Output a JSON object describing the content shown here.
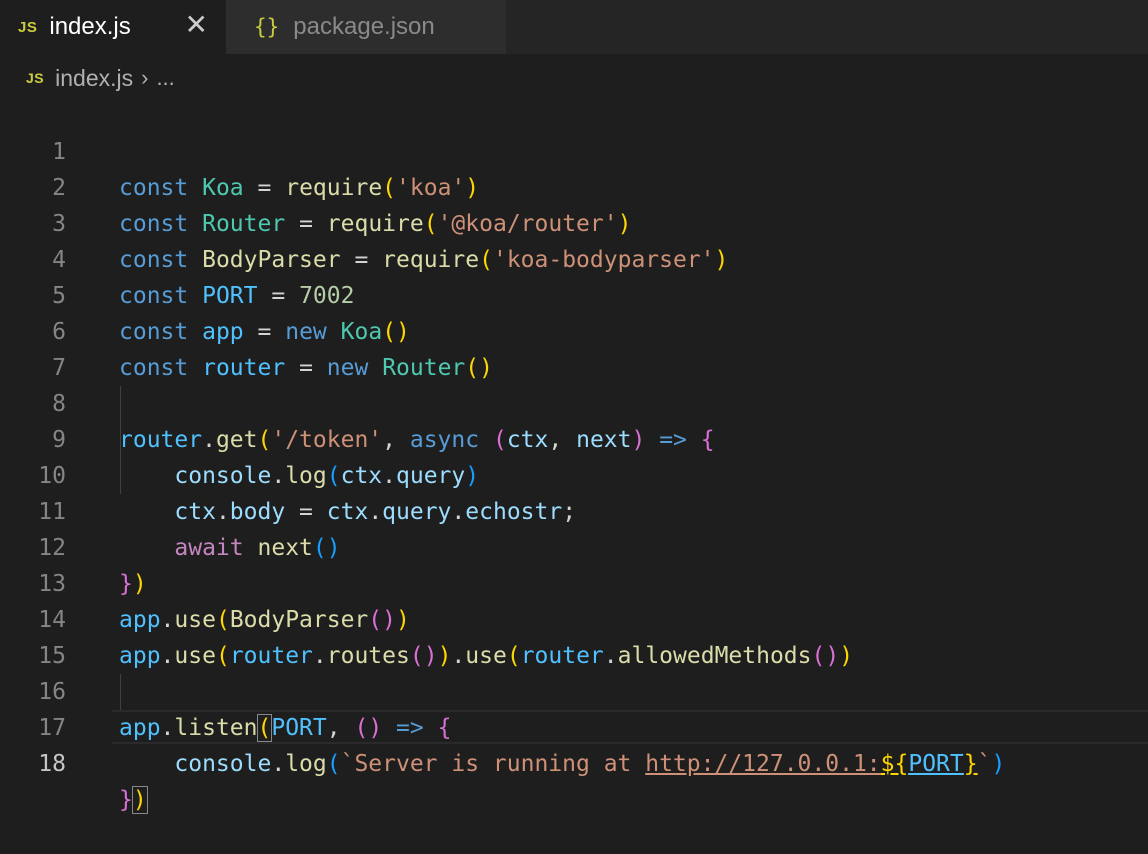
{
  "tabs": [
    {
      "icon": "JS",
      "label": "index.js",
      "active": true,
      "close": "✕"
    },
    {
      "icon": "{}",
      "label": "package.json",
      "active": false
    }
  ],
  "breadcrumb": {
    "icon": "JS",
    "file": "index.js",
    "separator": "›",
    "more": "..."
  },
  "editor": {
    "current_line": 18,
    "lines": [
      {
        "n": "1"
      },
      {
        "n": "2"
      },
      {
        "n": "3"
      },
      {
        "n": "4"
      },
      {
        "n": "5"
      },
      {
        "n": "6"
      },
      {
        "n": "7"
      },
      {
        "n": "8"
      },
      {
        "n": "9"
      },
      {
        "n": "10"
      },
      {
        "n": "11"
      },
      {
        "n": "12"
      },
      {
        "n": "13"
      },
      {
        "n": "14"
      },
      {
        "n": "15"
      },
      {
        "n": "16"
      },
      {
        "n": "17"
      },
      {
        "n": "18"
      }
    ],
    "code": {
      "l1": [
        "const",
        "Koa",
        "=",
        "require",
        "(",
        "'koa'",
        ")"
      ],
      "l2": [
        "const",
        "Router",
        "=",
        "require",
        "(",
        "'@koa/router'",
        ")"
      ],
      "l3": [
        "const",
        "BodyParser",
        "=",
        "require",
        "(",
        "'koa-bodyparser'",
        ")"
      ],
      "l4": [
        "const",
        "PORT",
        "=",
        "7002"
      ],
      "l5": [
        "const",
        "app",
        "=",
        "new",
        "Koa",
        "()"
      ],
      "l6": [
        "const",
        "router",
        "=",
        "new",
        "Router",
        "()"
      ],
      "l8": [
        "router",
        ".",
        "get",
        "(",
        "'/token'",
        ",",
        "async",
        "(",
        "ctx",
        ",",
        "next",
        ")",
        "=>",
        "{"
      ],
      "l9": [
        "console",
        ".",
        "log",
        "(",
        "ctx",
        ".",
        "query",
        ")"
      ],
      "l10": [
        "ctx",
        ".",
        "body",
        "=",
        "ctx",
        ".",
        "query",
        ".",
        "echostr",
        ";"
      ],
      "l11": [
        "await",
        "next",
        "()"
      ],
      "l12": [
        "}",
        ")"
      ],
      "l13": [
        "app",
        ".",
        "use",
        "(",
        "BodyParser",
        "()",
        ")"
      ],
      "l14": [
        "app",
        ".",
        "use",
        "(",
        "router",
        ".",
        "routes",
        "()",
        ")",
        ".",
        "use",
        "(",
        "router",
        ".",
        "allowedMethods",
        "()",
        ")"
      ],
      "l16": [
        "app",
        ".",
        "listen",
        "(",
        "PORT",
        ",",
        "()",
        "=>",
        "{"
      ],
      "l17": [
        "console",
        ".",
        "log",
        "(",
        "`Server is running at ",
        "http://127.0.0.1:",
        "${",
        "PORT",
        "}",
        "`",
        ")"
      ],
      "l18": [
        "}",
        ")"
      ]
    }
  },
  "colors": {
    "background": "#1e1e1e",
    "keyword": "#569cd6",
    "control": "#c586c0",
    "class": "#4ec9b0",
    "variable": "#9cdcfe",
    "function": "#dcdcaa",
    "string": "#ce9178",
    "number": "#b5cea8",
    "bracket1": "#ffd700",
    "bracket2": "#da70d6",
    "bracket3": "#179fff"
  }
}
